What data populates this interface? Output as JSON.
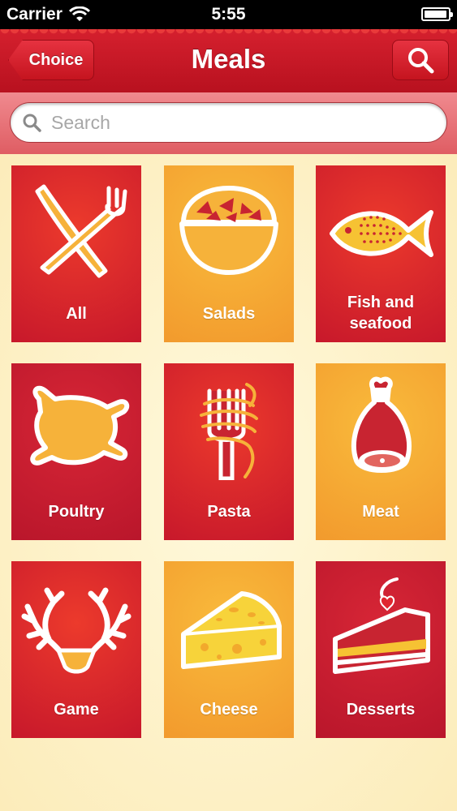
{
  "status_bar": {
    "carrier": "Carrier",
    "time": "5:55",
    "battery_level": 0.95
  },
  "nav": {
    "back_label": "Choice",
    "title": "Meals"
  },
  "search": {
    "placeholder": "Search",
    "value": ""
  },
  "colors": {
    "nav_red": "#c8151f",
    "tile_red": "#d42030",
    "tile_orange": "#f4a52f",
    "background": "#fdf1c8"
  },
  "categories": [
    {
      "label": "All",
      "icon": "fork-knife-icon"
    },
    {
      "label": "Salads",
      "icon": "salad-bowl-icon"
    },
    {
      "label": "Fish and seafood",
      "icon": "fish-icon"
    },
    {
      "label": "Poultry",
      "icon": "roast-chicken-icon"
    },
    {
      "label": "Pasta",
      "icon": "pasta-fork-icon"
    },
    {
      "label": "Meat",
      "icon": "ham-leg-icon"
    },
    {
      "label": "Game",
      "icon": "antlers-icon"
    },
    {
      "label": "Cheese",
      "icon": "cheese-wedge-icon"
    },
    {
      "label": "Desserts",
      "icon": "cake-slice-icon"
    }
  ]
}
